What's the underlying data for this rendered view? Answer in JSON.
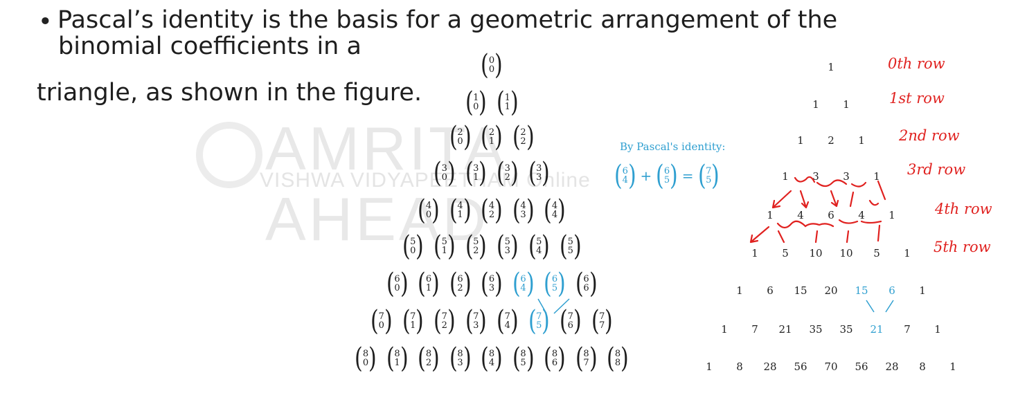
{
  "bullet": {
    "line1": "Pascal’s identity is the basis for a geometric arrangement of the",
    "line2": "binomial coefficients in a",
    "line3": "triangle, as shown in the figure."
  },
  "watermark": {
    "brand": "AMRITA AHEAD",
    "sub": "VISHWA VIDYAPEETHAM Online"
  },
  "identity": {
    "label": "By Pascal's identity:",
    "lhs1": {
      "n": "6",
      "k": "4"
    },
    "plus": "+",
    "lhs2": {
      "n": "6",
      "k": "5"
    },
    "equals": "=",
    "rhs": {
      "n": "7",
      "k": "5"
    }
  },
  "binomial_rows": [
    [
      {
        "n": "0",
        "k": "0"
      }
    ],
    [
      {
        "n": "1",
        "k": "0"
      },
      {
        "n": "1",
        "k": "1"
      }
    ],
    [
      {
        "n": "2",
        "k": "0"
      },
      {
        "n": "2",
        "k": "1"
      },
      {
        "n": "2",
        "k": "2"
      }
    ],
    [
      {
        "n": "3",
        "k": "0"
      },
      {
        "n": "3",
        "k": "1"
      },
      {
        "n": "3",
        "k": "2"
      },
      {
        "n": "3",
        "k": "3"
      }
    ],
    [
      {
        "n": "4",
        "k": "0"
      },
      {
        "n": "4",
        "k": "1"
      },
      {
        "n": "4",
        "k": "2"
      },
      {
        "n": "4",
        "k": "3"
      },
      {
        "n": "4",
        "k": "4"
      }
    ],
    [
      {
        "n": "5",
        "k": "0"
      },
      {
        "n": "5",
        "k": "1"
      },
      {
        "n": "5",
        "k": "2"
      },
      {
        "n": "5",
        "k": "3"
      },
      {
        "n": "5",
        "k": "4"
      },
      {
        "n": "5",
        "k": "5"
      }
    ],
    [
      {
        "n": "6",
        "k": "0"
      },
      {
        "n": "6",
        "k": "1"
      },
      {
        "n": "6",
        "k": "2"
      },
      {
        "n": "6",
        "k": "3"
      },
      {
        "n": "6",
        "k": "4",
        "hl": true
      },
      {
        "n": "6",
        "k": "5",
        "hl": true
      },
      {
        "n": "6",
        "k": "6"
      }
    ],
    [
      {
        "n": "7",
        "k": "0"
      },
      {
        "n": "7",
        "k": "1"
      },
      {
        "n": "7",
        "k": "2"
      },
      {
        "n": "7",
        "k": "3"
      },
      {
        "n": "7",
        "k": "4"
      },
      {
        "n": "7",
        "k": "5",
        "hl": true
      },
      {
        "n": "7",
        "k": "6"
      },
      {
        "n": "7",
        "k": "7"
      }
    ],
    [
      {
        "n": "8",
        "k": "0"
      },
      {
        "n": "8",
        "k": "1"
      },
      {
        "n": "8",
        "k": "2"
      },
      {
        "n": "8",
        "k": "3"
      },
      {
        "n": "8",
        "k": "4"
      },
      {
        "n": "8",
        "k": "5"
      },
      {
        "n": "8",
        "k": "6"
      },
      {
        "n": "8",
        "k": "7"
      },
      {
        "n": "8",
        "k": "8"
      }
    ]
  ],
  "number_rows": [
    [
      {
        "v": "1"
      }
    ],
    [
      {
        "v": "1"
      },
      {
        "v": "1"
      }
    ],
    [
      {
        "v": "1"
      },
      {
        "v": "2"
      },
      {
        "v": "1"
      }
    ],
    [
      {
        "v": "1"
      },
      {
        "v": "3"
      },
      {
        "v": "3"
      },
      {
        "v": "1"
      }
    ],
    [
      {
        "v": "1"
      },
      {
        "v": "4"
      },
      {
        "v": "6"
      },
      {
        "v": "4"
      },
      {
        "v": "1"
      }
    ],
    [
      {
        "v": "1"
      },
      {
        "v": "5"
      },
      {
        "v": "10"
      },
      {
        "v": "10"
      },
      {
        "v": "5"
      },
      {
        "v": "1"
      }
    ],
    [
      {
        "v": "1"
      },
      {
        "v": "6"
      },
      {
        "v": "15"
      },
      {
        "v": "20"
      },
      {
        "v": "15",
        "hl": true
      },
      {
        "v": "6",
        "hl": true
      },
      {
        "v": "1"
      }
    ],
    [
      {
        "v": "1"
      },
      {
        "v": "7"
      },
      {
        "v": "21"
      },
      {
        "v": "35"
      },
      {
        "v": "35"
      },
      {
        "v": "21",
        "hl": true
      },
      {
        "v": "7"
      },
      {
        "v": "1"
      }
    ],
    [
      {
        "v": "1"
      },
      {
        "v": "8"
      },
      {
        "v": "28"
      },
      {
        "v": "56"
      },
      {
        "v": "70"
      },
      {
        "v": "56"
      },
      {
        "v": "28"
      },
      {
        "v": "8"
      },
      {
        "v": "1"
      }
    ]
  ],
  "annotations": [
    {
      "text": "0th row"
    },
    {
      "text": "1st row"
    },
    {
      "text": "2nd row"
    },
    {
      "text": "3rd row"
    },
    {
      "text": "4th row"
    },
    {
      "text": "5th row"
    }
  ],
  "colors": {
    "highlight": "#2f9fd0",
    "ink": "#e0211f",
    "text": "#1e1e1e"
  }
}
